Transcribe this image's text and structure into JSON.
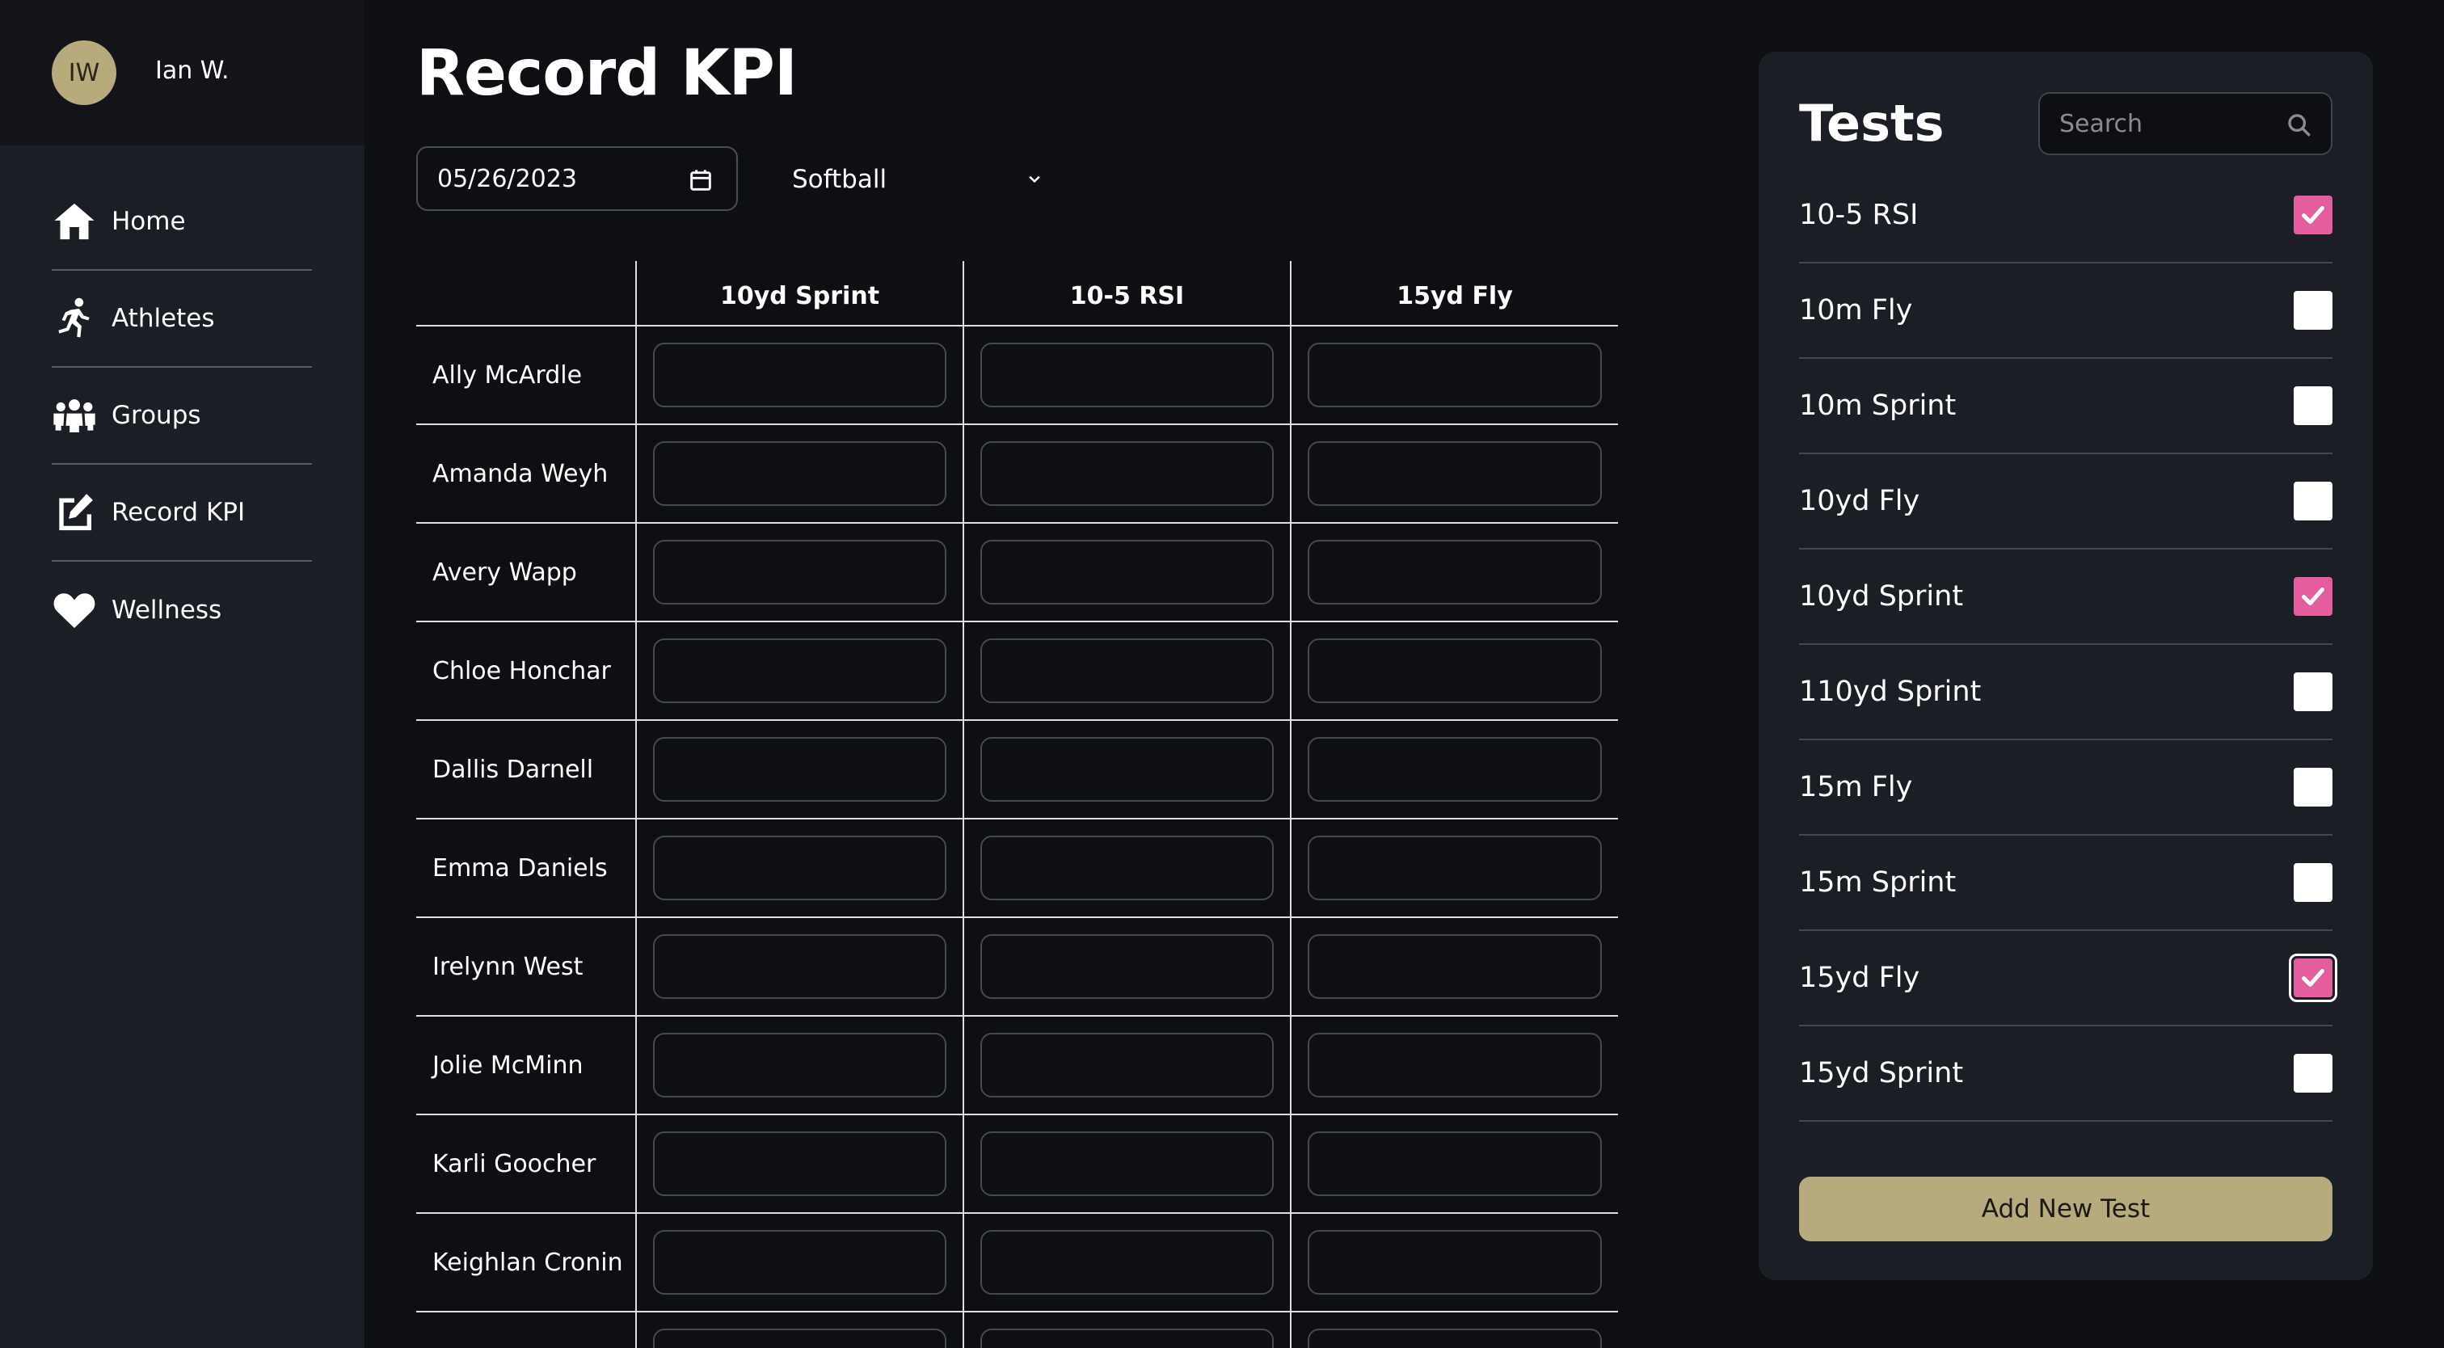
{
  "user": {
    "initials": "IW",
    "name": "Ian W."
  },
  "nav": [
    {
      "label": "Home",
      "icon": "home-icon"
    },
    {
      "label": "Athletes",
      "icon": "running-person-icon"
    },
    {
      "label": "Groups",
      "icon": "group-icon"
    },
    {
      "label": "Record KPI",
      "icon": "edit-icon"
    },
    {
      "label": "Wellness",
      "icon": "heart-icon"
    }
  ],
  "main": {
    "title": "Record KPI",
    "date": "05/26/2023",
    "sport": "Softball",
    "columns": [
      "10yd Sprint",
      "10-5 RSI",
      "15yd Fly"
    ],
    "athletes": [
      "Ally McArdle",
      "Amanda Weyh",
      "Avery Wapp",
      "Chloe Honchar",
      "Dallis Darnell",
      "Emma Daniels",
      "Irelynn West",
      "Jolie McMinn",
      "Karli Goocher",
      "Keighlan Cronin",
      ""
    ]
  },
  "tests": {
    "title": "Tests",
    "search_placeholder": "Search",
    "items": [
      {
        "label": "10-5 RSI",
        "checked": true
      },
      {
        "label": "10m Fly",
        "checked": false
      },
      {
        "label": "10m Sprint",
        "checked": false
      },
      {
        "label": "10yd Fly",
        "checked": false
      },
      {
        "label": "10yd Sprint",
        "checked": true
      },
      {
        "label": "110yd Sprint",
        "checked": false
      },
      {
        "label": "15m Fly",
        "checked": false
      },
      {
        "label": "15m Sprint",
        "checked": false
      },
      {
        "label": "15yd Fly",
        "checked": true,
        "focused": true
      },
      {
        "label": "15yd Sprint",
        "checked": false
      }
    ],
    "add_label": "Add New Test"
  },
  "colors": {
    "accent_gold": "#b7aa7d",
    "check_pink": "#e35d9f",
    "sidebar_bg": "#1b1e25",
    "page_bg": "#0e0f12"
  }
}
